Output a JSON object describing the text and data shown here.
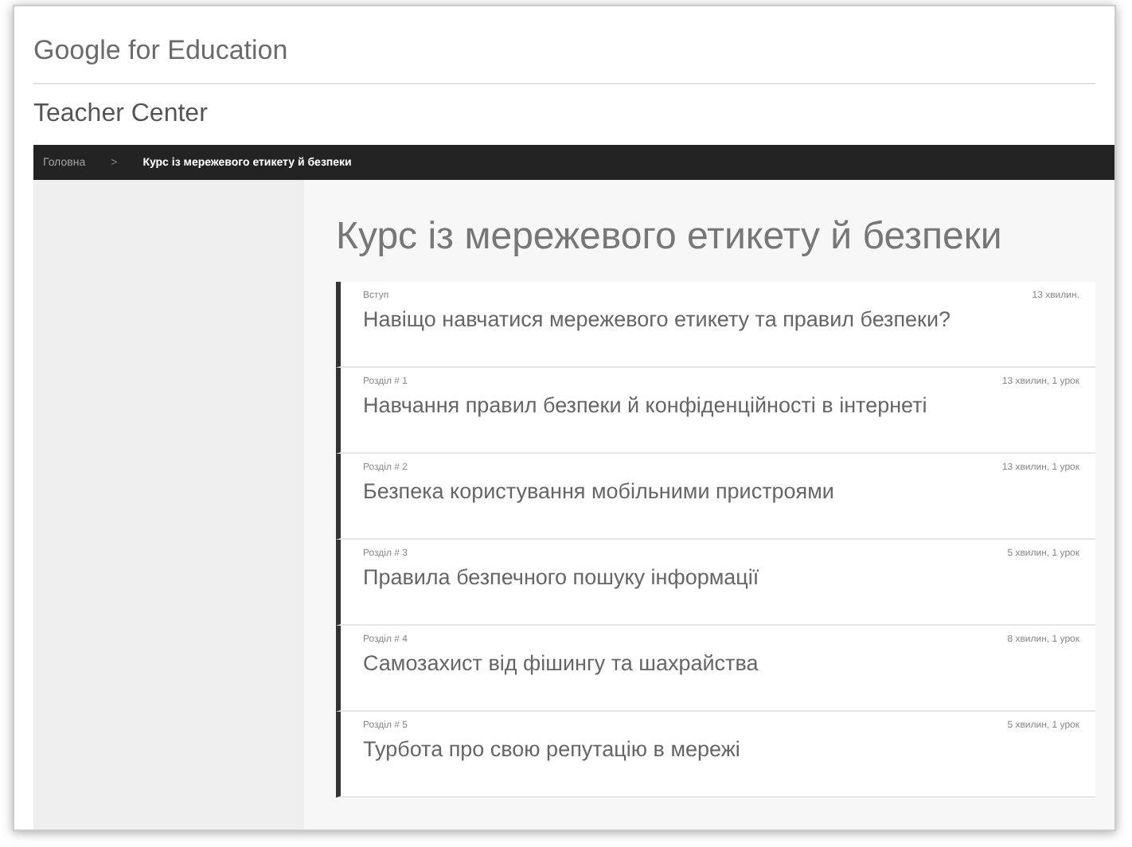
{
  "header": {
    "logo": "Google for Education",
    "site_title": "Teacher Center"
  },
  "breadcrumb": [
    {
      "label": "Головна",
      "current": false
    },
    {
      "label": "Курс із мережевого етикету й безпеки",
      "current": true
    }
  ],
  "breadcrumb_separator": ">",
  "course": {
    "title": "Курс із мережевого етикету й безпеки",
    "sections": [
      {
        "label": "Вступ",
        "title": "Навіщо навчатися мережевого етикету та правил безпеки?",
        "duration": "13 хвилин."
      },
      {
        "label": "Розділ # 1",
        "title": "Навчання правил безпеки й конфіденційності в інтернеті",
        "duration": "13 хвилин, 1 урок"
      },
      {
        "label": "Розділ # 2",
        "title": "Безпека користування мобільними пристроями",
        "duration": "13 хвилин, 1 урок"
      },
      {
        "label": "Розділ # 3",
        "title": "Правила безпечного пошуку інформації",
        "duration": "5 хвилин, 1 урок"
      },
      {
        "label": "Розділ # 4",
        "title": "Самозахист від фішингу та шахрайства",
        "duration": "8 хвилин, 1 урок"
      },
      {
        "label": "Розділ # 5",
        "title": "Турбота про свою репутацію в мережі",
        "duration": "5 хвилин, 1 урок"
      }
    ]
  }
}
